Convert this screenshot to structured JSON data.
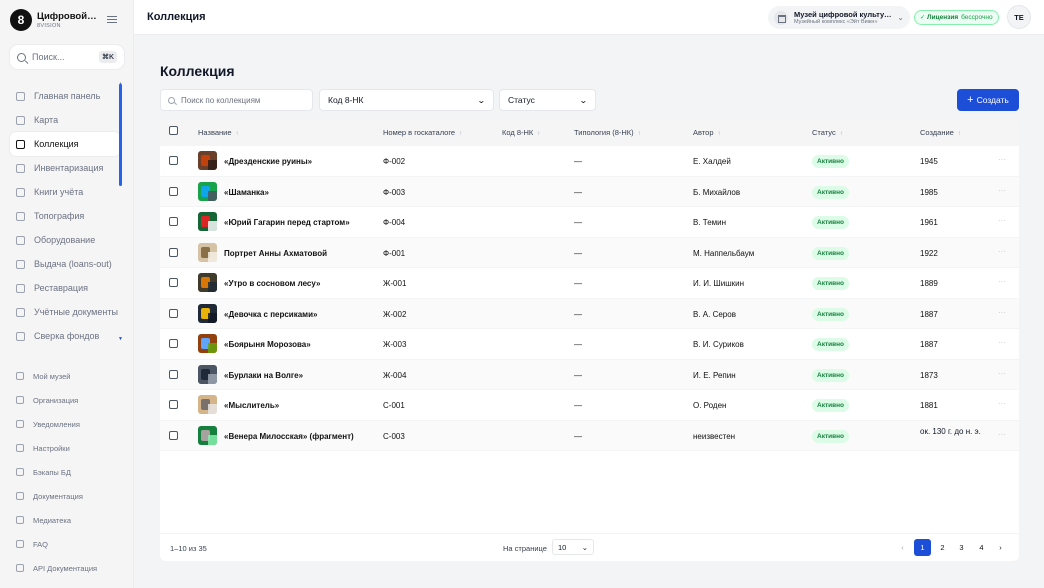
{
  "brand": {
    "logo_char": "8",
    "name": "Цифровой музей",
    "sub": "8VISION"
  },
  "sidebar": {
    "search_label": "Поиск...",
    "shortcut": "⌘K",
    "items": [
      {
        "label": "Главная панель",
        "icon": "dashboard-icon"
      },
      {
        "label": "Карта",
        "icon": "map-icon"
      },
      {
        "label": "Коллекция",
        "icon": "collection-icon",
        "active": true
      },
      {
        "label": "Инвентаризация",
        "icon": "inventory-icon"
      },
      {
        "label": "Книги учёта",
        "icon": "book-icon"
      },
      {
        "label": "Топография",
        "icon": "topography-icon"
      },
      {
        "label": "Оборудование",
        "icon": "equipment-icon"
      },
      {
        "label": "Выдача (loans-out)",
        "icon": "loans-icon"
      },
      {
        "label": "Реставрация",
        "icon": "restoration-icon"
      },
      {
        "label": "Учётные документы",
        "icon": "documents-icon"
      },
      {
        "label": "Сверка фондов",
        "icon": "reconciliation-icon"
      }
    ],
    "secondary": [
      {
        "label": "Мой музей",
        "icon": "museum-icon"
      },
      {
        "label": "Организация",
        "icon": "organization-icon"
      },
      {
        "label": "Уведомления",
        "icon": "bell-icon"
      },
      {
        "label": "Настройки",
        "icon": "gear-icon"
      },
      {
        "label": "Бэкапы БД",
        "icon": "database-icon"
      },
      {
        "label": "Документация",
        "icon": "docs-icon"
      },
      {
        "label": "Медиатека",
        "icon": "media-icon"
      },
      {
        "label": "FAQ",
        "icon": "help-icon"
      },
      {
        "label": "API Документация",
        "icon": "code-icon"
      }
    ]
  },
  "topbar": {
    "title": "Коллекция",
    "org_name": "Музей цифровой культуры",
    "org_sub": "Музейный комплекс «Эйт Вижн»",
    "license_label": "Лицензия",
    "license_note": "бессрочно",
    "avatar": "TE"
  },
  "page": {
    "title": "Коллекция",
    "search_placeholder": "Поиск по коллекциям",
    "filter_code": "Код 8-НК",
    "filter_status": "Статус",
    "create_label": "Создать"
  },
  "table": {
    "columns": [
      "Название",
      "Номер в госкаталоге",
      "Код 8-НК",
      "Типология (8-НК)",
      "Автор",
      "Статус",
      "Создание"
    ],
    "rows": [
      {
        "name": "«Дрезденские руины»",
        "number": "Ф-002",
        "typology": "—",
        "author": "Е. Халдей",
        "status": "Активно",
        "year": "1945",
        "thumb": [
          "#6b3f2a",
          "#c2410c",
          "#2b1d16"
        ]
      },
      {
        "name": "«Шаманка»",
        "number": "Ф-003",
        "typology": "—",
        "author": "Б. Михайлов",
        "status": "Активно",
        "year": "1985",
        "thumb": [
          "#16a34a",
          "#0ea5e9",
          "#4b5563"
        ]
      },
      {
        "name": "«Юрий Гагарин перед стартом»",
        "number": "Ф-004",
        "typology": "—",
        "author": "В. Темин",
        "status": "Активно",
        "year": "1961",
        "thumb": [
          "#166534",
          "#dc2626",
          "#f9fafb"
        ]
      },
      {
        "name": "Портрет Анны Ахматовой",
        "number": "Ф-001",
        "typology": "—",
        "author": "М. Наппельбаум",
        "status": "Активно",
        "year": "1922",
        "thumb": [
          "#d6c3a5",
          "#8b6f47",
          "#f5efe3"
        ]
      },
      {
        "name": "«Утро в сосновом лесу»",
        "number": "Ж-001",
        "typology": "—",
        "author": "И. И. Шишкин",
        "status": "Активно",
        "year": "1889",
        "thumb": [
          "#3f3a2a",
          "#d97706",
          "#1f2937"
        ]
      },
      {
        "name": "«Девочка с персиками»",
        "number": "Ж-002",
        "typology": "—",
        "author": "В. А. Серов",
        "status": "Активно",
        "year": "1887",
        "thumb": [
          "#1f2937",
          "#eab308",
          "#111827"
        ]
      },
      {
        "name": "«Боярыня Морозова»",
        "number": "Ж-003",
        "typology": "—",
        "author": "В. И. Суриков",
        "status": "Активно",
        "year": "1887",
        "thumb": [
          "#92400e",
          "#60a5fa",
          "#65a30d"
        ]
      },
      {
        "name": "«Бурлаки на Волге»",
        "number": "Ж-004",
        "typology": "—",
        "author": "И. Е. Репин",
        "status": "Активно",
        "year": "1873",
        "thumb": [
          "#4b5563",
          "#1f2937",
          "#9ca3af"
        ]
      },
      {
        "name": "«Мыслитель»",
        "number": "С-001",
        "typology": "—",
        "author": "О. Роден",
        "status": "Активно",
        "year": "1881",
        "thumb": [
          "#d6b48a",
          "#78716c",
          "#e7e5e4"
        ]
      },
      {
        "name": "«Венера Милосская» (фрагмент)",
        "number": "С-003",
        "typology": "—",
        "author": "неизвестен",
        "status": "Активно",
        "year": "ок. 130 г. до н. э.",
        "thumb": [
          "#15803d",
          "#a8a29e",
          "#86efac"
        ]
      }
    ],
    "row_action": "···"
  },
  "footer": {
    "count": "1–10 из 35",
    "per_page_label": "На странице",
    "per_page": "10",
    "prev": "‹",
    "pages": [
      "1",
      "2",
      "3",
      "4"
    ],
    "next": "›"
  },
  "colors": {
    "accent": "#1d4ed8",
    "status_bg": "#dcfce7",
    "status_fg": "#15803d"
  }
}
